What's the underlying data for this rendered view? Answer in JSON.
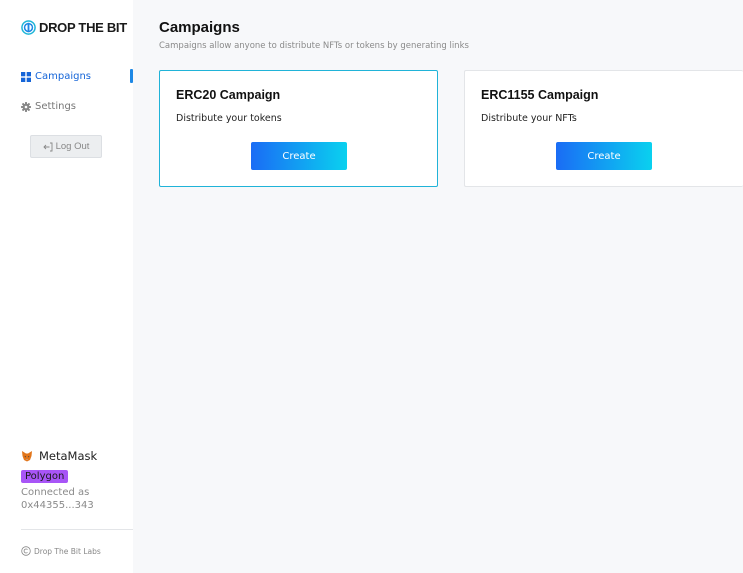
{
  "brand": {
    "name": "DROP THE BIT",
    "accent": "#1e88e5"
  },
  "sidebar": {
    "items": [
      {
        "label": "Campaigns",
        "icon": "grid-icon",
        "active": true
      },
      {
        "label": "Settings",
        "icon": "gear-icon",
        "active": false
      }
    ],
    "logout_label": "Log Out"
  },
  "wallet": {
    "name": "MetaMask",
    "icon": "metamask-fox-icon",
    "network": "Polygon",
    "network_color": "#a855f7",
    "connected_label": "Connected as",
    "address": "0x44355...343"
  },
  "footer": {
    "text": "Drop The Bit Labs",
    "icon": "copyright-icon"
  },
  "main": {
    "title": "Campaigns",
    "subtitle": "Campaigns allow anyone to distribute NFTs or tokens by generating links",
    "cards": [
      {
        "title": "ERC20 Campaign",
        "description": "Distribute your tokens",
        "button": "Create",
        "selected": true
      },
      {
        "title": "ERC1155 Campaign",
        "description": "Distribute your NFTs",
        "button": "Create",
        "selected": false
      }
    ]
  }
}
